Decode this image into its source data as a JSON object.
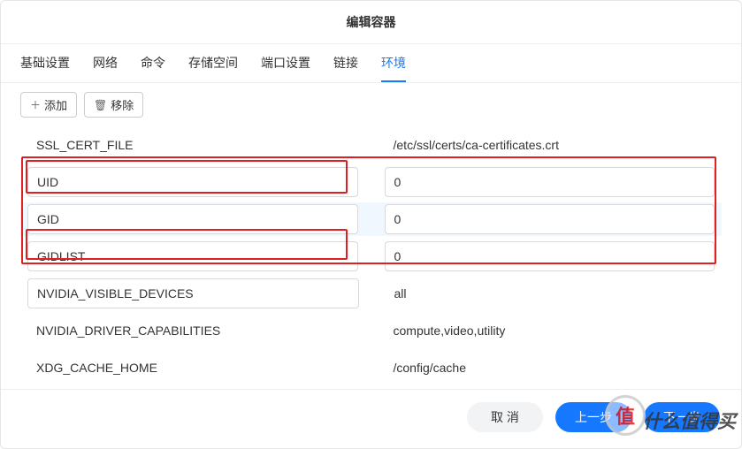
{
  "header": {
    "title": "编辑容器"
  },
  "tabs": [
    {
      "label": "基础设置"
    },
    {
      "label": "网络"
    },
    {
      "label": "命令"
    },
    {
      "label": "存储空间"
    },
    {
      "label": "端口设置"
    },
    {
      "label": "链接"
    },
    {
      "label": "环境",
      "active": true
    }
  ],
  "toolbar": {
    "add": "添加",
    "remove": "移除"
  },
  "env": [
    {
      "key": "SSL_CERT_FILE",
      "value": "/etc/ssl/certs/ca-certificates.crt",
      "editable": false
    },
    {
      "key": "UID",
      "value": "0",
      "editable": true
    },
    {
      "key": "GID",
      "value": "0",
      "editable": true,
      "highlight": true
    },
    {
      "key": "GIDLIST",
      "value": "0",
      "editable": true
    },
    {
      "key": "NVIDIA_VISIBLE_DEVICES",
      "value": "all",
      "editable": true,
      "keyEditable": false
    },
    {
      "key": "NVIDIA_DRIVER_CAPABILITIES",
      "value": "compute,video,utility",
      "editable": false
    },
    {
      "key": "XDG_CACHE_HOME",
      "value": "/config/cache",
      "editable": false
    }
  ],
  "footer": {
    "cancel": "取 消",
    "prev": "上一步",
    "next": "下一步"
  },
  "watermark": {
    "text": "什么值得买"
  }
}
